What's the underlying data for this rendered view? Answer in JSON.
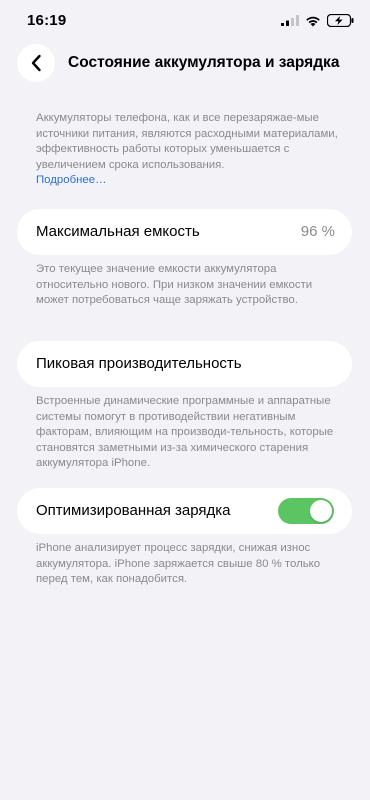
{
  "status_bar": {
    "time": "16:19",
    "icons": [
      "cellular-signal-icon",
      "wifi-icon",
      "battery-charging-icon"
    ]
  },
  "header": {
    "back_icon": "chevron-left-icon",
    "title": "Состояние аккумулятора и зарядка"
  },
  "intro": {
    "text": "Аккумуляторы телефона, как и все перезаряжае-мые источники питания, являются расходными материалами, эффективность работы которых уменьшается с увеличением срока использования.",
    "link_label": "Подробнее…"
  },
  "max_capacity": {
    "label": "Максимальная емкость",
    "value": "96 %",
    "description": "Это текущее значение емкости аккумулятора относительно нового. При низком значении емкости может потребоваться чаще заряжать устройство."
  },
  "peak_performance": {
    "label": "Пиковая производительность",
    "description": "Встроенные динамические программные и аппаратные системы помогут в противодействии негативным факторам, влияющим на производи-тельность, которые становятся заметными из-за химического старения аккумулятора iPhone."
  },
  "optimized_charging": {
    "label": "Оптимизированная зарядка",
    "enabled": true,
    "description": "iPhone анализирует процесс зарядки, снижая износ аккумулятора. iPhone заряжается свыше 80 % только перед тем, как понадобится."
  },
  "colors": {
    "background": "#f2f2f7",
    "toggle_on": "#5cc563",
    "link": "#2f6fd6",
    "secondary_text": "#8a8a8e"
  }
}
